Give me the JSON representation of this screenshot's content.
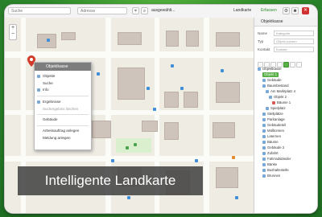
{
  "toolbar": {
    "search_placeholder": "Suche",
    "address_placeholder": "Adresse",
    "location_text": "ausgewählt...",
    "layer_label": "Landkarte",
    "mode_label": "Erfassen",
    "colors": {
      "active_green": "#58b046",
      "close_red": "#d13030"
    }
  },
  "panel": {
    "title": "Objektkasse",
    "fields": [
      {
        "label": "Name",
        "placeholder": "Kategorie"
      },
      {
        "label": "Typ",
        "placeholder": "Objekt suchen"
      },
      {
        "label": "Kontakt",
        "placeholder": "Kontakt"
      }
    ],
    "tree": [
      "Objektkasse",
      "Objekt 1",
      "Gebäude",
      "Baumbestand",
      "Am Marktplatz 4",
      "Objekt 2",
      "Bäume 1",
      "Spielplatz",
      "Stellplätze",
      "Parkanlage",
      "Gebäudeteil",
      "Mülltonnen",
      "Laternen",
      "Bäume",
      "Gebäude 2",
      "Zufahrt",
      "Fahrradständer",
      "Bänke",
      "Bushaltestelle",
      "Brunnen"
    ]
  },
  "context_menu": {
    "header": "Objektkasse",
    "items": [
      "Objekte",
      "Suche",
      "Info",
      "Ergebnisse",
      "Suchergebnis löschen",
      "Gebäude",
      "Arbeitsauftrag anlegen",
      "Meldung anlegen"
    ]
  },
  "caption": {
    "text": "Intelligente Landkarte"
  }
}
